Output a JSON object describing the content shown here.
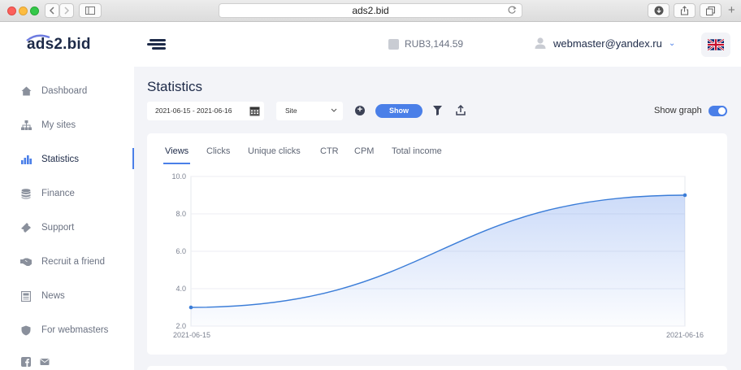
{
  "browser": {
    "url": "ads2.bid"
  },
  "header": {
    "logo": "ads2.bid",
    "balance": "RUB3,144.59",
    "user_email": "webmaster@yandex.ru",
    "language": "en-GB flag"
  },
  "sidebar": {
    "items": [
      {
        "label": "Dashboard",
        "icon": "home-icon",
        "active": false
      },
      {
        "label": "My sites",
        "icon": "sitemap-icon",
        "active": false
      },
      {
        "label": "Statistics",
        "icon": "bar-chart-icon",
        "active": true
      },
      {
        "label": "Finance",
        "icon": "database-icon",
        "active": false
      },
      {
        "label": "Support",
        "icon": "ticket-icon",
        "active": false
      },
      {
        "label": "Recruit a friend",
        "icon": "handshake-icon",
        "active": false
      },
      {
        "label": "News",
        "icon": "newspaper-icon",
        "active": false
      },
      {
        "label": "For webmasters",
        "icon": "shield-icon",
        "active": false
      }
    ],
    "social": [
      "facebook-icon",
      "mail-icon"
    ]
  },
  "main": {
    "title": "Statistics",
    "date_range": "2021-06-15 - 2021-06-16",
    "site_select": "Site",
    "show_button": "Show",
    "show_graph_label": "Show graph",
    "show_graph_on": true,
    "tabs": [
      "Views",
      "Clicks",
      "Unique clicks",
      "CTR",
      "CPM",
      "Total income"
    ],
    "active_tab": "Views"
  },
  "colors": {
    "accent": "#4a7fe8",
    "navy": "#1d2a48",
    "line": "#3b7dd8"
  },
  "chart_data": {
    "type": "area",
    "x": [
      "2021-06-15",
      "2021-06-16"
    ],
    "series": [
      {
        "values": [
          3.0,
          9.0
        ]
      }
    ],
    "ylim": [
      2.0,
      10.0
    ],
    "yticks": [
      "2.0",
      "4.0",
      "6.0",
      "8.0",
      "10.0"
    ],
    "grid": true,
    "title": "",
    "xlabel": "",
    "ylabel": ""
  }
}
